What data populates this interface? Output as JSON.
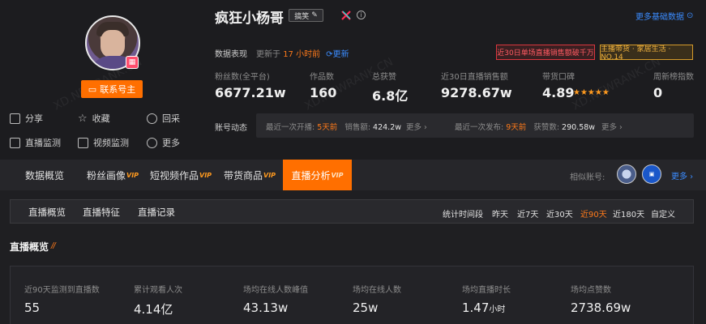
{
  "profile": {
    "name": "疯狂小杨哥",
    "tag_label": "搞笑",
    "contact_button": "联系号主",
    "more_basic": "更多基础数据",
    "watermark": "XD.NEWRANK.CN"
  },
  "actions": [
    {
      "label": "分享",
      "icon": "share-icon"
    },
    {
      "label": "收藏",
      "icon": "star-icon"
    },
    {
      "label": "回采",
      "icon": "refresh-icon"
    },
    {
      "label": "直播监测",
      "icon": "live-monitor-icon"
    },
    {
      "label": "视频监测",
      "icon": "video-monitor-icon"
    },
    {
      "label": "更多",
      "icon": "more-icon"
    }
  ],
  "data_perf": {
    "label": "数据表现",
    "update_prefix": "更新于",
    "update_time": "17 小时前",
    "refresh_label": "更新",
    "badge_red": "近30日单场直播销售额破千万",
    "badge_gold": "主播带货 · 家居生活 · NO.14"
  },
  "stats": [
    {
      "label": "粉丝数(全平台)",
      "value": "6677.21w"
    },
    {
      "label": "作品数",
      "value": "160"
    },
    {
      "label": "总获赞",
      "value": "6.8亿"
    },
    {
      "label": "近30日直播销售额",
      "value": "9278.67w"
    },
    {
      "label": "带货口碑",
      "value": "4.89",
      "stars": "★★★★★"
    },
    {
      "label": "周新榜指数",
      "value": "0"
    }
  ],
  "dynamics": {
    "label": "账号动态",
    "live_prefix": "最近一次开播:",
    "live_time": "5天前",
    "sales_label": "销售额:",
    "sales_value": "424.2w",
    "more1": "更多 ›",
    "post_prefix": "最近一次发布:",
    "post_time": "9天前",
    "likes_label": "获赞数:",
    "likes_value": "290.58w",
    "more2": "更多 ›"
  },
  "tabs": [
    {
      "label": "数据概览",
      "vip": ""
    },
    {
      "label": "粉丝画像",
      "vip": "VIP"
    },
    {
      "label": "短视频作品",
      "vip": "VIP"
    },
    {
      "label": "带货商品",
      "vip": "VIP"
    },
    {
      "label": "直播分析",
      "vip": "VIP"
    }
  ],
  "similar": {
    "label": "相似账号:",
    "more": "更多 ›"
  },
  "subnav": {
    "items": [
      "直播概览",
      "直播特征",
      "直播记录"
    ],
    "range_label": "统计时间段",
    "ranges": [
      "昨天",
      "近7天",
      "近30天",
      "近90天",
      "近180天",
      "自定义"
    ],
    "active_range": "近90天"
  },
  "section": {
    "title": "直播概览"
  },
  "overview": [
    {
      "label": "近90天监测到直播数",
      "value": "55",
      "unit": ""
    },
    {
      "label": "累计观看人次",
      "value": "4.14亿",
      "unit": ""
    },
    {
      "label": "场均在线人数峰值",
      "value": "43.13w",
      "unit": ""
    },
    {
      "label": "场均在线人数",
      "value": "25w",
      "unit": ""
    },
    {
      "label": "场均直播时长",
      "value": "1.47",
      "unit": "小时"
    },
    {
      "label": "场均点赞数",
      "value": "2738.69w",
      "unit": ""
    }
  ],
  "colors": {
    "accent": "#ff6f00",
    "link": "#3b8cff",
    "background": "#1f1f22"
  }
}
